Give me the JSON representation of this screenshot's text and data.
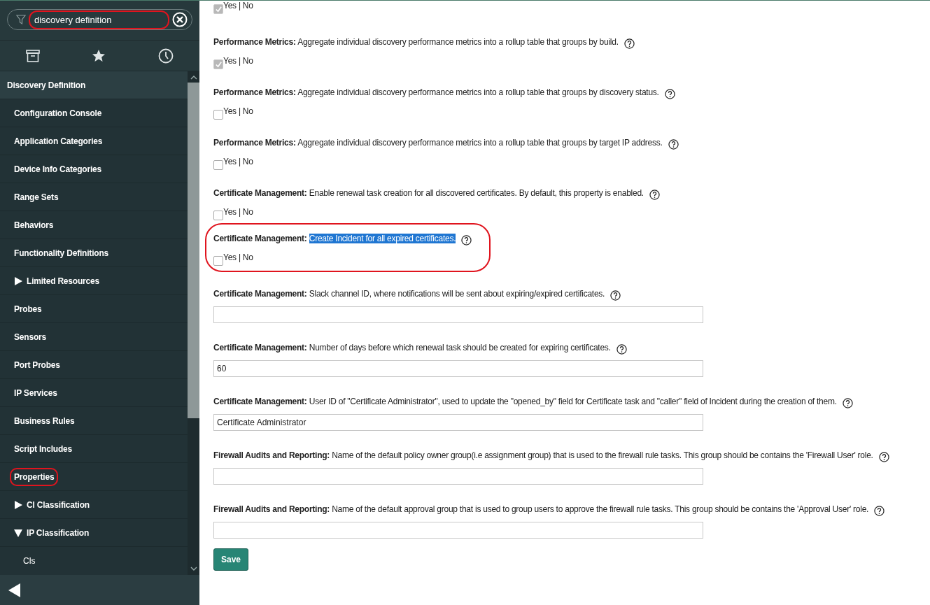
{
  "sidebar": {
    "search": {
      "value": "discovery definition",
      "annotated": true
    },
    "items": [
      {
        "label": "Discovery Definition",
        "kind": "header",
        "annotated": false
      },
      {
        "label": "Configuration Console",
        "kind": "link",
        "annotated": false
      },
      {
        "label": "Application Categories",
        "kind": "link",
        "annotated": false
      },
      {
        "label": "Device Info Categories",
        "kind": "link",
        "annotated": false
      },
      {
        "label": "Range Sets",
        "kind": "link",
        "annotated": false
      },
      {
        "label": "Behaviors",
        "kind": "link",
        "annotated": false
      },
      {
        "label": "Functionality Definitions",
        "kind": "link",
        "annotated": false
      },
      {
        "label": "Limited Resources",
        "kind": "folder",
        "expanded": false,
        "annotated": false
      },
      {
        "label": "Probes",
        "kind": "link",
        "annotated": false
      },
      {
        "label": "Sensors",
        "kind": "link",
        "annotated": false
      },
      {
        "label": "Port Probes",
        "kind": "link",
        "annotated": false
      },
      {
        "label": "IP Services",
        "kind": "link",
        "annotated": false
      },
      {
        "label": "Business Rules",
        "kind": "link",
        "annotated": false
      },
      {
        "label": "Script Includes",
        "kind": "link",
        "annotated": false
      },
      {
        "label": "Properties",
        "kind": "link",
        "annotated": true
      },
      {
        "label": "CI Classification",
        "kind": "folder",
        "expanded": false,
        "annotated": false
      },
      {
        "label": "IP Classification",
        "kind": "folder",
        "expanded": true,
        "annotated": false,
        "children": [
          {
            "label": "CIs",
            "annotated": false
          }
        ]
      }
    ]
  },
  "properties": [
    {
      "kind": "checkbox",
      "option_label": "Yes | No",
      "checked": true,
      "disabled": true,
      "annotated": false
    },
    {
      "kind": "checkbox",
      "category": "Performance Metrics:",
      "description": "Aggregate individual discovery performance metrics into a rollup table that groups by build.",
      "option_label": "Yes | No",
      "checked": true,
      "disabled": true,
      "annotated": false
    },
    {
      "kind": "checkbox",
      "category": "Performance Metrics:",
      "description": "Aggregate individual discovery performance metrics into a rollup table that groups by discovery status.",
      "option_label": "Yes | No",
      "checked": false,
      "disabled": false,
      "annotated": false
    },
    {
      "kind": "checkbox",
      "category": "Performance Metrics:",
      "description": "Aggregate individual discovery performance metrics into a rollup table that groups by target IP address.",
      "option_label": "Yes | No",
      "checked": false,
      "disabled": false,
      "annotated": false
    },
    {
      "kind": "checkbox",
      "category": "Certificate Management:",
      "description": "Enable renewal task creation for all discovered certificates. By default, this property is enabled.",
      "option_label": "Yes | No",
      "checked": false,
      "disabled": false,
      "annotated": false
    },
    {
      "kind": "checkbox",
      "category": "Certificate Management:",
      "description": "Create Incident for all expired certificates.",
      "description_selected": true,
      "option_label": "Yes | No",
      "checked": false,
      "disabled": false,
      "annotated": true
    },
    {
      "kind": "text",
      "category": "Certificate Management:",
      "description": "Slack channel ID, where notifications will be sent about expiring/expired certificates.",
      "annotated": false
    },
    {
      "kind": "text",
      "category": "Certificate Management:",
      "description": "Number of days before which renewal task should be created for expiring certificates.",
      "value": "60",
      "annotated": false
    },
    {
      "kind": "text",
      "category": "Certificate Management:",
      "description": "User ID of \"Certificate Administrator\", used to update the \"opened_by\" field for Certificate task and \"caller\" field of Incident during the creation of them.",
      "value": "Certificate Administrator",
      "annotated": false
    },
    {
      "kind": "text",
      "category": "Firewall Audits and Reporting:",
      "description": "Name of the default policy owner group(i.e assignment group) that is used to the firewall rule tasks. This group should be contains the 'Firewall User' role.",
      "annotated": false
    },
    {
      "kind": "text",
      "category": "Firewall Audits and Reporting:",
      "description": "Name of the default approval group that is used to group users to approve the firewall rule tasks. This group should be contains the 'Approval User' role.",
      "annotated": false
    }
  ],
  "save_button": "Save"
}
